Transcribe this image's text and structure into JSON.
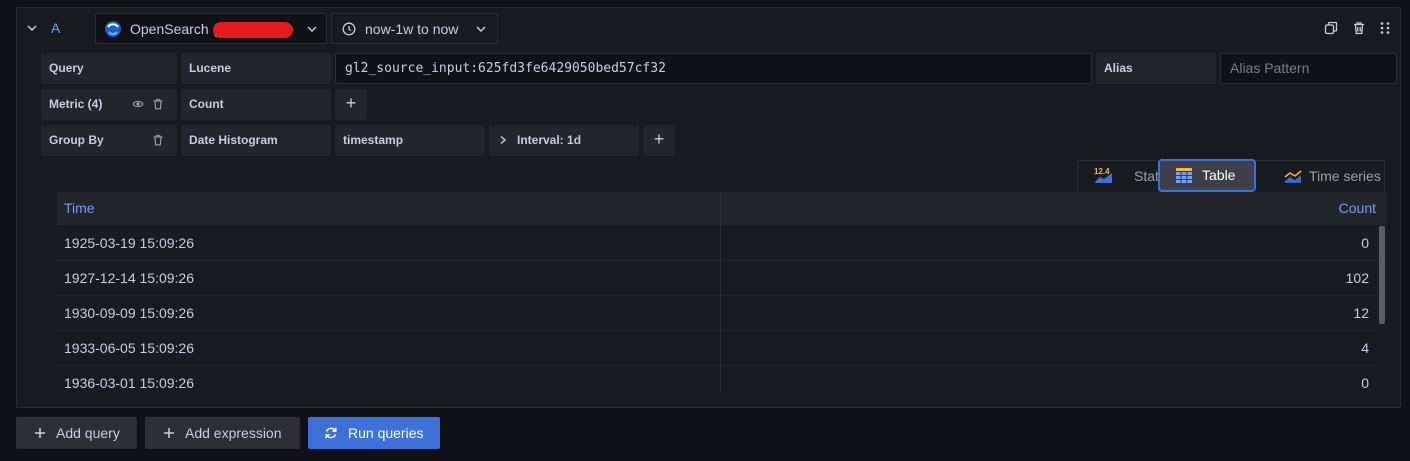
{
  "query": {
    "ref_id": "A",
    "datasource_name": "OpenSearch (",
    "time_range": "now-1w to now"
  },
  "rows": {
    "query": {
      "label": "Query",
      "type": "Lucene",
      "value": "gl2_source_input:625fd3fe6429050bed57cf32",
      "alias_label": "Alias",
      "alias_placeholder": "Alias Pattern"
    },
    "metric": {
      "label": "Metric (4)",
      "value": "Count"
    },
    "group_by": {
      "label": "Group By",
      "type": "Date Histogram",
      "field": "timestamp",
      "interval": "Interval: 1d"
    }
  },
  "viz": {
    "options": [
      {
        "label": "Stat",
        "active": false
      },
      {
        "label": "Table",
        "active": true
      },
      {
        "label": "Time series",
        "active": false
      }
    ],
    "stat_icon_text": "12.4"
  },
  "table": {
    "columns": [
      "Time",
      "Count"
    ],
    "rows": [
      {
        "time": "1925-03-19 15:09:26",
        "count": "0"
      },
      {
        "time": "1927-12-14 15:09:26",
        "count": "102"
      },
      {
        "time": "1930-09-09 15:09:26",
        "count": "12"
      },
      {
        "time": "1933-06-05 15:09:26",
        "count": "4"
      },
      {
        "time": "1936-03-01 15:09:26",
        "count": "0"
      }
    ]
  },
  "actions": {
    "add_query": "Add query",
    "add_expression": "Add expression",
    "run_queries": "Run queries"
  },
  "colors": {
    "accent": "#3d71d9",
    "link": "#6e9fff",
    "redaction": "#e8191c"
  }
}
